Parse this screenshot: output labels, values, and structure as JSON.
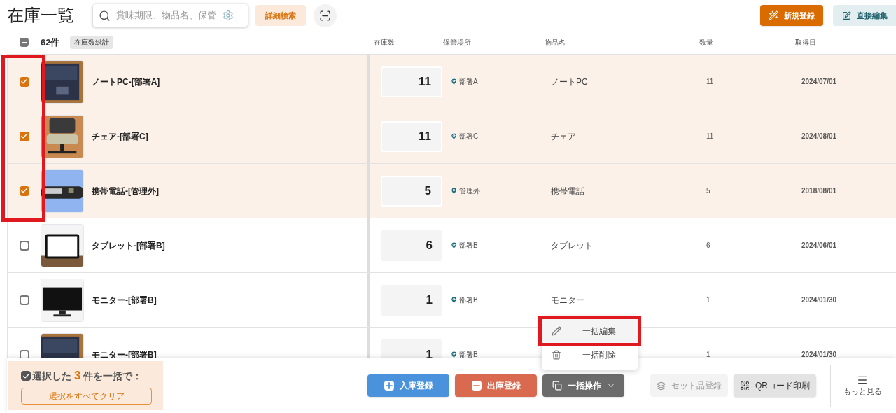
{
  "title": "在庫一覧",
  "search": {
    "placeholder": "賞味期限、物品名、保管"
  },
  "advanced_search_button": "詳細検索",
  "new_button": "新規登録",
  "direct_edit_button": "直接編集",
  "list_header": {
    "select_all_indeterminate": true,
    "count": "62件",
    "total_badge": "在庫数総計"
  },
  "columns": [
    "在庫数",
    "保管場所",
    "物品名",
    "数量",
    "取得日"
  ],
  "rows": [
    {
      "name": "ノートPC-[部署A]",
      "selected": true,
      "stock": "11",
      "location": "部署A",
      "item": "ノートPC",
      "quantity": "11",
      "date": "2024/07/01"
    },
    {
      "name": "チェア-[部署C]",
      "selected": true,
      "stock": "11",
      "location": "部署C",
      "item": "チェア",
      "quantity": "11",
      "date": "2024/08/01"
    },
    {
      "name": "携帯電話-[管理外]",
      "selected": true,
      "stock": "5",
      "location": "管理外",
      "item": "携帯電話",
      "quantity": "5",
      "date": "2018/08/01"
    },
    {
      "name": "タブレット-[部署B]",
      "selected": false,
      "stock": "6",
      "location": "部署B",
      "item": "タブレット",
      "quantity": "6",
      "date": "2024/06/01"
    },
    {
      "name": "モニター-[部署B]",
      "selected": false,
      "stock": "1",
      "location": "部署B",
      "item": "モニター",
      "quantity": "1",
      "date": "2024/01/30"
    },
    {
      "name": "モニター-[部署B]",
      "selected": false,
      "stock": "1",
      "location": "部署B",
      "quantity": "1",
      "date": "2024/01/30"
    }
  ],
  "bulk_bar": {
    "prefix": "選択した",
    "count": "3",
    "suffix": "件を一括で：",
    "clear_button": "選択をすべてクリア"
  },
  "actions": [
    {
      "kind": "in",
      "label": "入庫登録",
      "disabled": false
    },
    {
      "kind": "out",
      "label": "出庫登録",
      "disabled": false
    },
    {
      "kind": "bulk",
      "label": "一括操作",
      "disabled": false
    },
    {
      "kind": "set",
      "label": "セット品登録",
      "disabled": true
    },
    {
      "kind": "qr",
      "label": "QRコード印刷",
      "disabled": false
    },
    {
      "kind": "more",
      "label": "もっと見る",
      "disabled": false
    }
  ],
  "menu": [
    {
      "kind": "edit",
      "label": "一括編集",
      "selected": true
    },
    {
      "kind": "delete",
      "label": "一括削除",
      "selected": false
    }
  ]
}
